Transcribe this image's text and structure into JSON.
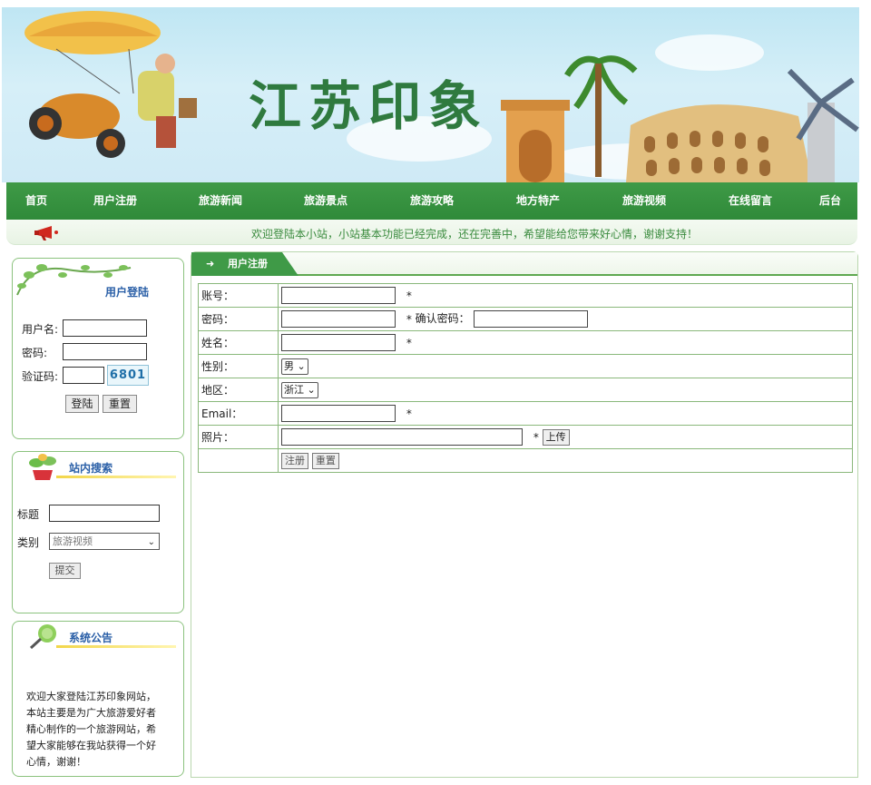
{
  "banner": {
    "title": "江苏印象"
  },
  "nav": {
    "items": [
      {
        "label": "首页"
      },
      {
        "label": "用户注册"
      },
      {
        "label": "旅游新闻"
      },
      {
        "label": "旅游景点"
      },
      {
        "label": "旅游攻略"
      },
      {
        "label": "地方特产"
      },
      {
        "label": "旅游视频"
      },
      {
        "label": "在线留言"
      },
      {
        "label": "后台"
      }
    ]
  },
  "notice_bar": {
    "text": "欢迎登陆本小站，小站基本功能已经完成，还在完善中，希望能给您带来好心情，谢谢支持！"
  },
  "login": {
    "title": "用户登陆",
    "username_label": "用户名:",
    "password_label": "密码:",
    "captcha_label": "验证码:",
    "captcha_value": "6801",
    "login_button": "登陆",
    "reset_button": "重置"
  },
  "search": {
    "title": "站内搜索",
    "title_label": "标题",
    "category_label": "类别",
    "category_selected": "旅游视频",
    "submit_button": "提交"
  },
  "announcement": {
    "title": "系统公告",
    "body": "欢迎大家登陆江苏印象网站，本站主要是为广大旅游爱好者精心制作的一个旅游网站，希望大家能够在我站获得一个好心情，谢谢！"
  },
  "register": {
    "tab_label": "用户注册",
    "account_label": "账号：",
    "password_label": "密码：",
    "confirm_password_label": "确认密码：",
    "name_label": "姓名：",
    "gender_label": "性别：",
    "gender_value": "男",
    "region_label": "地区：",
    "region_value": "浙江",
    "email_label": "Email：",
    "photo_label": "照片：",
    "required_mark": "*",
    "upload_button": "上传",
    "submit_button": "注册",
    "reset_button": "重置"
  },
  "colors": {
    "nav_green": "#3f9a47",
    "title_blue": "#2a5fa7",
    "notice_green": "#3a8b3e",
    "border_green": "#8ab87b"
  }
}
